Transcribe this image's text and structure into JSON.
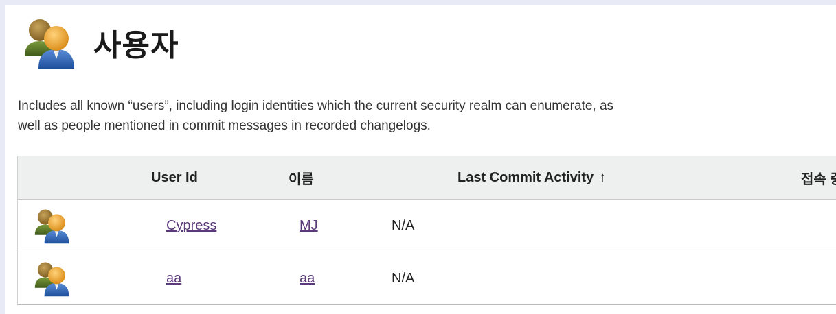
{
  "page": {
    "title": "사용자",
    "description_line1": "Includes all known “users”, including login identities which the current security realm can enumerate, as",
    "description_line2": "well as people mentioned in commit messages in recorded changelogs."
  },
  "icons": {
    "header": "people-icon",
    "row": "user-icon"
  },
  "table": {
    "columns": {
      "user_id": "User Id",
      "name": "이름",
      "last_commit": "Last Commit Activity",
      "sort_indicator": "↑",
      "online": "접속 중"
    },
    "rows": [
      {
        "user_id": "Cypress",
        "name": "MJ",
        "last_commit": "N/A",
        "online": ""
      },
      {
        "user_id": "aa",
        "name": "aa",
        "last_commit": "N/A",
        "online": ""
      }
    ]
  },
  "colors": {
    "link": "#5a3a7a",
    "header_bg": "#eef0f0",
    "page_bg": "#e8ebf5"
  }
}
